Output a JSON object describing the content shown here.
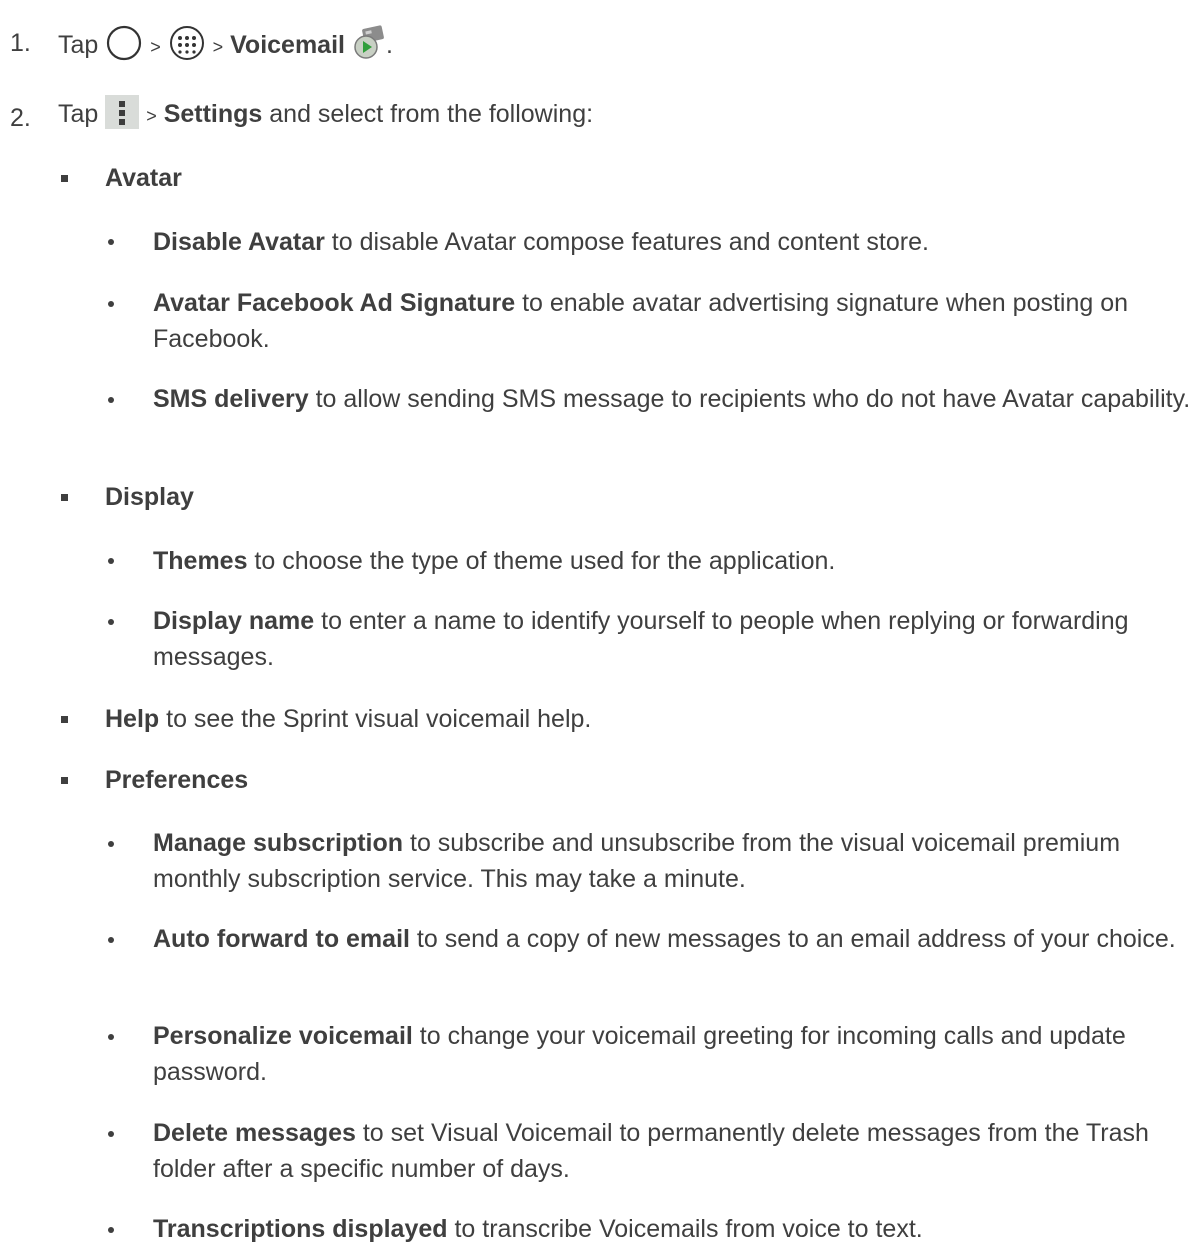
{
  "steps": [
    {
      "num": "1.",
      "tap": "Tap",
      "gt1": ">",
      "gt2": ">",
      "target": "Voicemail",
      "end": "."
    },
    {
      "num": "2.",
      "tap": "Tap",
      "gt": ">",
      "target": "Settings",
      "rest": " and select from the following:"
    }
  ],
  "sections": [
    {
      "title": "Avatar",
      "items": [
        {
          "label": "Disable Avatar",
          "text": " to disable Avatar compose features and content store."
        },
        {
          "label": "Avatar Facebook Ad Signature",
          "text": " to enable avatar advertising signature when posting on Facebook."
        },
        {
          "label": "SMS delivery",
          "text": " to allow sending SMS message to recipients who do not have Avatar capability."
        }
      ]
    },
    {
      "title": "Display",
      "items": [
        {
          "label": "Themes",
          "text": " to choose the type of theme used for the application."
        },
        {
          "label": "Display name",
          "text": " to enter a name to identify yourself to people when replying or forwarding messages."
        }
      ]
    },
    {
      "title": "Help",
      "title_rest": " to see the Sprint visual voicemail help."
    },
    {
      "title": "Preferences",
      "items": [
        {
          "label": "Manage subscription",
          "text": " to subscribe and unsubscribe from the visual voicemail premium monthly subscription service. This may take a minute."
        },
        {
          "label": "Auto forward to email",
          "text": " to send a copy of new messages to an email address of your choice."
        },
        {
          "label": "Personalize voicemail",
          "text": " to change your voicemail greeting for incoming calls and update password."
        },
        {
          "label": "Delete messages",
          "text": " to set Visual Voicemail to permanently delete messages from the Trash folder after a specific number of days."
        },
        {
          "label": "Transcriptions displayed",
          "text": " to transcribe Voicemails from voice to text."
        }
      ]
    }
  ]
}
